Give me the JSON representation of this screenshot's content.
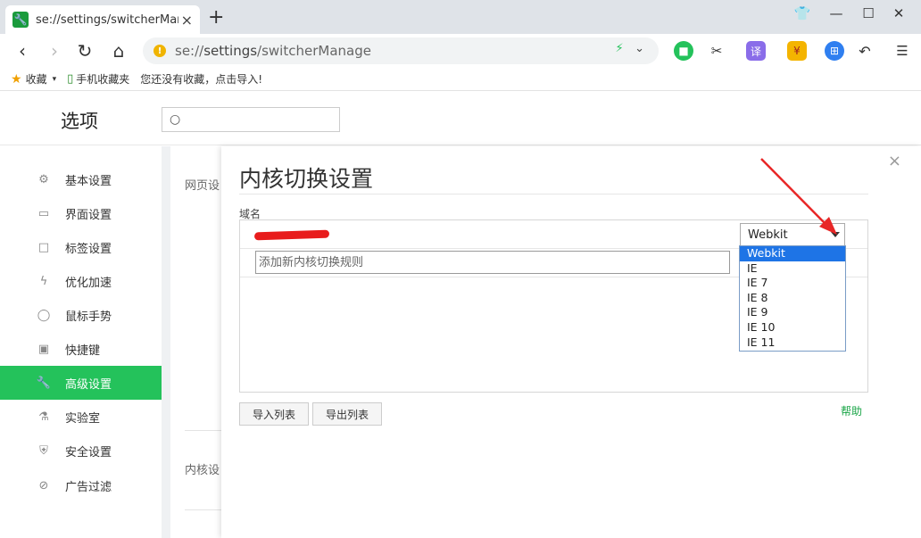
{
  "tab": {
    "title": "se://settings/switcherManage",
    "close": "×"
  },
  "window": {
    "shirt": "👕",
    "minimize": "—",
    "maximize": "☐",
    "close": "✕",
    "newtab": "+"
  },
  "toolbar": {
    "url_scheme": "se://",
    "url_host": "settings",
    "url_path": "/switcherManage",
    "nav_back": "‹",
    "nav_forward": "›",
    "reload": "↻",
    "home": "⌂",
    "addr_bolt": "⚡",
    "addr_dropdown": "⌄",
    "translate": "译",
    "menu": "☰"
  },
  "bookmarks": {
    "favorites": "收藏",
    "favorites_caret": "▾",
    "mobile": "手机收藏夹",
    "empty_hint": "您还没有收藏，点击导入!"
  },
  "settings": {
    "title": "选项",
    "search_icon": "○",
    "sidebar": [
      {
        "label": "基本设置",
        "icon": "⚙"
      },
      {
        "label": "界面设置",
        "icon": "▭"
      },
      {
        "label": "标签设置",
        "icon": "□"
      },
      {
        "label": "优化加速",
        "icon": "ϟ"
      },
      {
        "label": "鼠标手势",
        "icon": "◯"
      },
      {
        "label": "快捷键",
        "icon": "▣"
      },
      {
        "label": "高级设置",
        "icon": "🔧"
      },
      {
        "label": "实验室",
        "icon": "⚗"
      },
      {
        "label": "安全设置",
        "icon": "⛨"
      },
      {
        "label": "广告过滤",
        "icon": "⊘"
      }
    ],
    "bg_label_1": "网页设",
    "bg_label_2": "内核设"
  },
  "dialog": {
    "title": "内核切换设置",
    "close": "×",
    "column_label": "域名",
    "selected_engine": "Webkit",
    "add_placeholder": "添加新内核切换规则",
    "engine_options": [
      "Webkit",
      "IE",
      "IE 7",
      "IE 8",
      "IE 9",
      "IE 10",
      "IE 11"
    ],
    "import_button": "导入列表",
    "export_button": "导出列表",
    "help_link": "帮助"
  },
  "colors": {
    "accent": "#24c25b",
    "selection": "#1e74e6",
    "arrow": "#e82626"
  }
}
